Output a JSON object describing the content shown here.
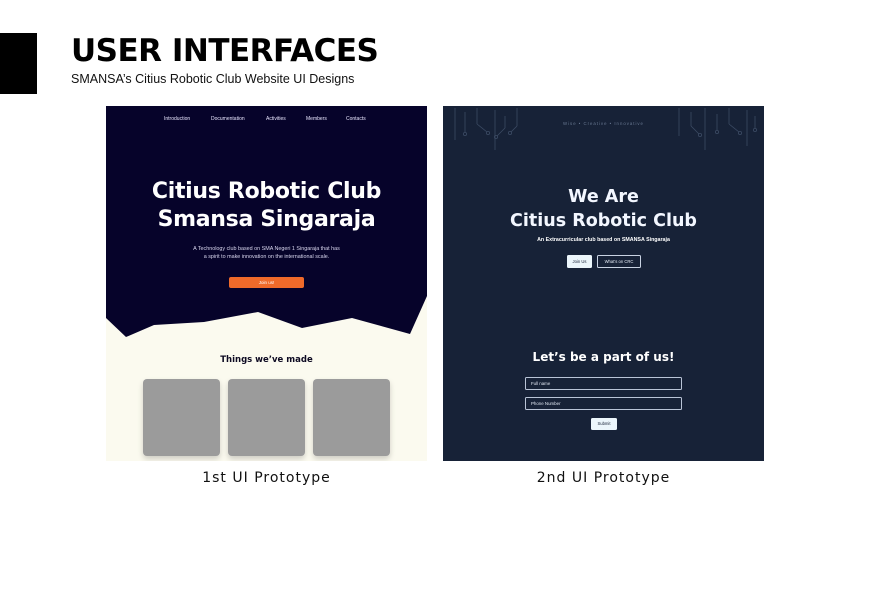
{
  "header": {
    "title": "USER INTERFACES",
    "subtitle": "SMANSA’s Citius Robotic Club Website UI Designs"
  },
  "prototype_1": {
    "caption": "1st UI Prototype",
    "nav": [
      "Introduction",
      "Documentation",
      "Activities",
      "Members",
      "Contacts"
    ],
    "hero_title_line1": "Citius Robotic Club",
    "hero_title_line2": "Smansa Singaraja",
    "hero_description_line1": "A Technology club based on SMA Negeri 1 Singaraja that has",
    "hero_description_line2": "a spirit to make innovation on the international scale.",
    "join_label": "Join us!",
    "section_title": "Things we’ve made",
    "colors": {
      "hero": "#06032a",
      "accent": "#ef6a2a",
      "page": "#fbfaef",
      "card": "#9b9b9b"
    }
  },
  "prototype_2": {
    "caption": "2nd UI Prototype",
    "tagline": "Wise • Creative • Innovative",
    "title_line1": "We Are",
    "title_line2": "Citius Robotic Club",
    "subtitle": "An Extracurricular club based on SMANSA Singaraja",
    "join_label": "Join Us",
    "whats_label": "What’s on CRC",
    "cta": "Let’s be a part of us!",
    "name_placeholder": "Full name",
    "phone_placeholder": "Phone Number",
    "submit_label": "Submit",
    "colors": {
      "background": "#172237",
      "button": "#ecf6fb"
    }
  }
}
